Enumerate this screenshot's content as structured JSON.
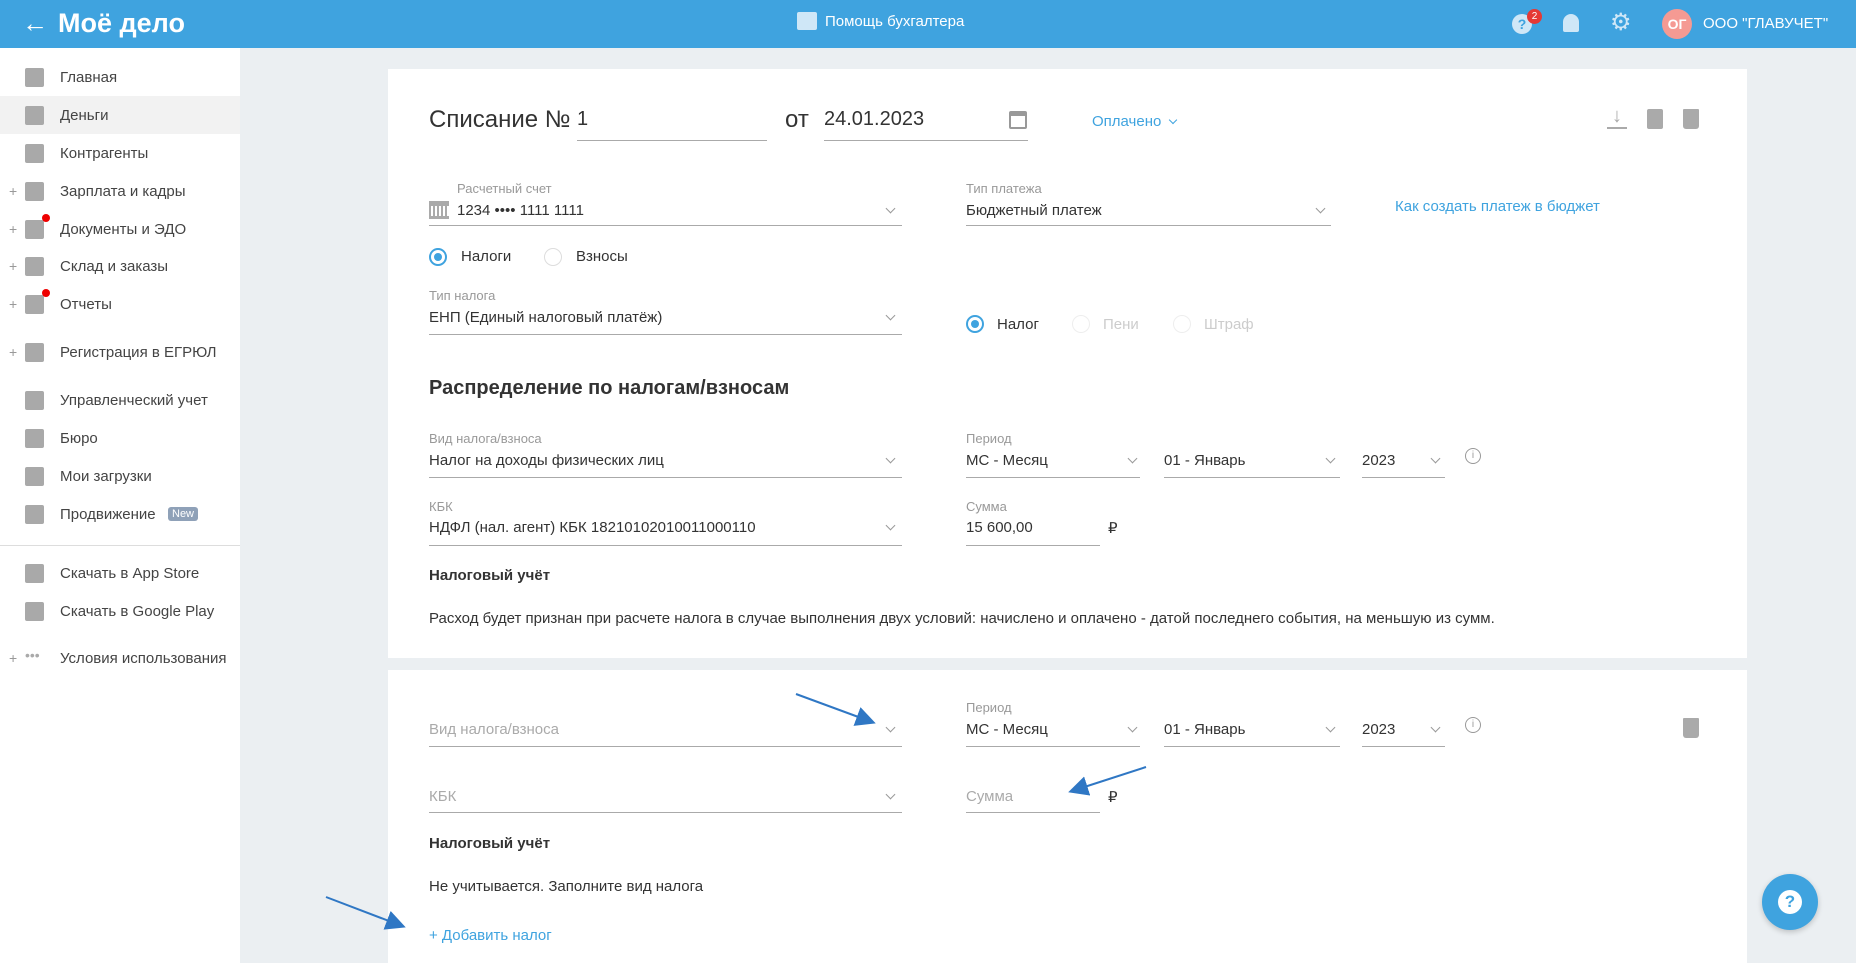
{
  "header": {
    "logo": "Моё дело",
    "help_link": "Помощь бухгалтера",
    "help_badge": "2",
    "avatar_initials": "ОГ",
    "org_name": "ООО \"ГЛАВУЧЕТ\""
  },
  "sidebar": {
    "items": [
      {
        "label": "Главная",
        "icon": "home-icon"
      },
      {
        "label": "Деньги",
        "icon": "money-icon",
        "active": true
      },
      {
        "label": "Контрагенты",
        "icon": "contractor-icon"
      },
      {
        "label": "Зарплата и кадры",
        "icon": "salary-icon",
        "expand": true
      },
      {
        "label": "Документы и ЭДО",
        "icon": "documents-icon",
        "expand": true,
        "dot": true
      },
      {
        "label": "Склад и заказы",
        "icon": "warehouse-icon",
        "expand": true
      },
      {
        "label": "Отчеты",
        "icon": "reports-icon",
        "expand": true,
        "dot": true
      },
      {
        "label": "Регистрация в ЕГРЮЛ",
        "icon": "registration-icon",
        "expand": true
      },
      {
        "label": "Управленческий учет",
        "icon": "management-icon"
      },
      {
        "label": "Бюро",
        "icon": "briefcase-icon"
      },
      {
        "label": "Мои загрузки",
        "icon": "folder-icon"
      },
      {
        "label": "Продвижение",
        "icon": "promotion-icon",
        "badge": "New"
      }
    ],
    "bottom": [
      {
        "label": "Скачать в App Store",
        "icon": "apple-icon"
      },
      {
        "label": "Скачать в Google Play",
        "icon": "google-play-icon"
      },
      {
        "label": "Условия использования",
        "icon": "more-icon",
        "expand": true
      }
    ]
  },
  "doc": {
    "title": "Списание №",
    "number": "1",
    "from_label": "от",
    "date": "24.01.2023",
    "status": "Оплачено",
    "account_label": "Расчетный счет",
    "account_value": "1234 •••• 1111 1111",
    "payment_type_label": "Тип платежа",
    "payment_type_value": "Бюджетный платеж",
    "budget_link": "Как создать платеж в бюджет",
    "radio_taxes": "Налоги",
    "radio_contrib": "Взносы",
    "tax_type_label": "Тип налога",
    "tax_type_value": "ЕНП (Единый налоговый платёж)",
    "kind_tax": "Налог",
    "kind_penalty": "Пени",
    "kind_fine": "Штраф",
    "distribution_title": "Распределение по налогам/взносам"
  },
  "rows": [
    {
      "tax_label": "Вид налога/взноса",
      "tax_value": "Налог на доходы физических лиц",
      "period_label": "Период",
      "period_type": "МС - Месяц",
      "month": "01 - Январь",
      "year": "2023",
      "kbk_label": "КБК",
      "kbk_value": "НДФЛ (нал. агент) КБК 18210102010011000110",
      "sum_label": "Сумма",
      "sum_value": "15 600,00",
      "currency": "₽",
      "accounting_title": "Налоговый учёт",
      "accounting_text": "Расход будет признан при расчете налога в случае выполнения двух условий: начислено и оплачено - датой последнего события, на меньшую из сумм."
    },
    {
      "tax_placeholder": "Вид налога/взноса",
      "period_label": "Период",
      "period_type": "МС - Месяц",
      "month": "01 - Январь",
      "year": "2023",
      "kbk_placeholder": "КБК",
      "sum_placeholder": "Сумма",
      "currency": "₽",
      "accounting_title": "Налоговый учёт",
      "accounting_text": "Не учитывается. Заполните вид налога"
    }
  ],
  "add_tax": "+ Добавить налог",
  "colors": {
    "header": "#3fa3df",
    "accent": "#3fa3df",
    "annotation": "#2f77c4"
  }
}
